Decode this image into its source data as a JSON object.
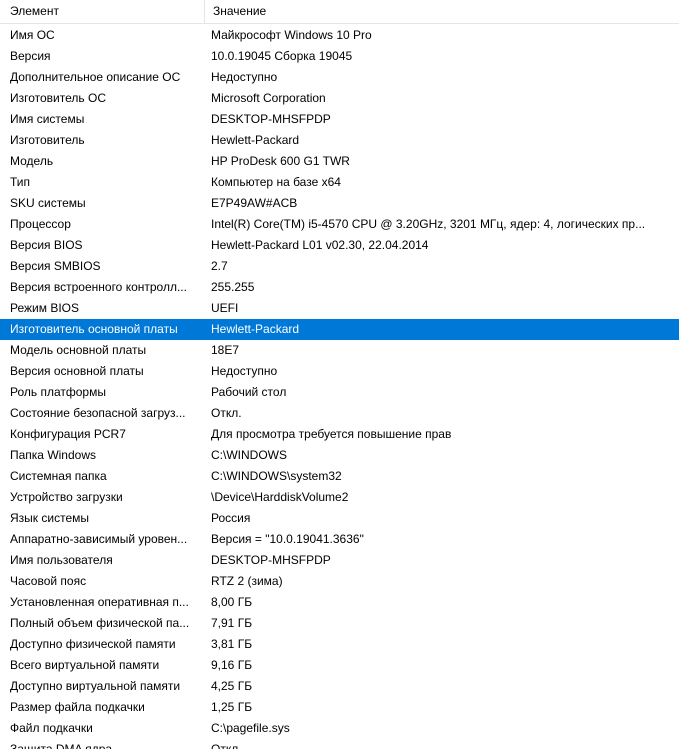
{
  "columns": {
    "element": "Элемент",
    "value": "Значение"
  },
  "selected_row": 15,
  "rows": [
    {
      "name": "Имя ОС",
      "value": "Майкрософт Windows 10 Pro"
    },
    {
      "name": "Версия",
      "value": "10.0.19045 Сборка 19045"
    },
    {
      "name": "Дополнительное описание ОС",
      "value": "Недоступно"
    },
    {
      "name": "Изготовитель ОС",
      "value": "Microsoft Corporation"
    },
    {
      "name": "Имя системы",
      "value": "DESKTOP-MHSFPDP"
    },
    {
      "name": "Изготовитель",
      "value": "Hewlett-Packard"
    },
    {
      "name": "Модель",
      "value": "HP ProDesk 600 G1 TWR"
    },
    {
      "name": "Тип",
      "value": "Компьютер на базе x64"
    },
    {
      "name": "SKU системы",
      "value": "E7P49AW#ACB"
    },
    {
      "name": "Процессор",
      "value": "Intel(R) Core(TM) i5-4570 CPU @ 3.20GHz, 3201 МГц, ядер: 4, логических пр..."
    },
    {
      "name": "Версия BIOS",
      "value": "Hewlett-Packard L01 v02.30, 22.04.2014"
    },
    {
      "name": "Версия SMBIOS",
      "value": "2.7"
    },
    {
      "name": "Версия встроенного контролл...",
      "value": "255.255"
    },
    {
      "name": "Режим BIOS",
      "value": "UEFI"
    },
    {
      "name": "Изготовитель основной платы",
      "value": "Hewlett-Packard"
    },
    {
      "name": "Модель основной платы",
      "value": "18E7"
    },
    {
      "name": "Версия основной платы",
      "value": "Недоступно"
    },
    {
      "name": "Роль платформы",
      "value": "Рабочий стол"
    },
    {
      "name": "Состояние безопасной загруз...",
      "value": "Откл."
    },
    {
      "name": "Конфигурация PCR7",
      "value": "Для просмотра требуется повышение прав"
    },
    {
      "name": "Папка Windows",
      "value": "C:\\WINDOWS"
    },
    {
      "name": "Системная папка",
      "value": "C:\\WINDOWS\\system32"
    },
    {
      "name": "Устройство загрузки",
      "value": "\\Device\\HarddiskVolume2"
    },
    {
      "name": "Язык системы",
      "value": "Россия"
    },
    {
      "name": "Аппаратно-зависимый уровен...",
      "value": "Версия = \"10.0.19041.3636\""
    },
    {
      "name": "Имя пользователя",
      "value": "DESKTOP-MHSFPDP"
    },
    {
      "name": "Часовой пояс",
      "value": "RTZ 2 (зима)"
    },
    {
      "name": "Установленная оперативная п...",
      "value": "8,00 ГБ"
    },
    {
      "name": "Полный объем физической па...",
      "value": "7,91 ГБ"
    },
    {
      "name": "Доступно физической памяти",
      "value": "3,81 ГБ"
    },
    {
      "name": "Всего виртуальной памяти",
      "value": "9,16 ГБ"
    },
    {
      "name": "Доступно виртуальной памяти",
      "value": "4,25 ГБ"
    },
    {
      "name": "Размер файла подкачки",
      "value": "1,25 ГБ"
    },
    {
      "name": "Файл подкачки",
      "value": "C:\\pagefile.sys"
    },
    {
      "name": "Защита DMA ядра",
      "value": "Откл."
    }
  ]
}
